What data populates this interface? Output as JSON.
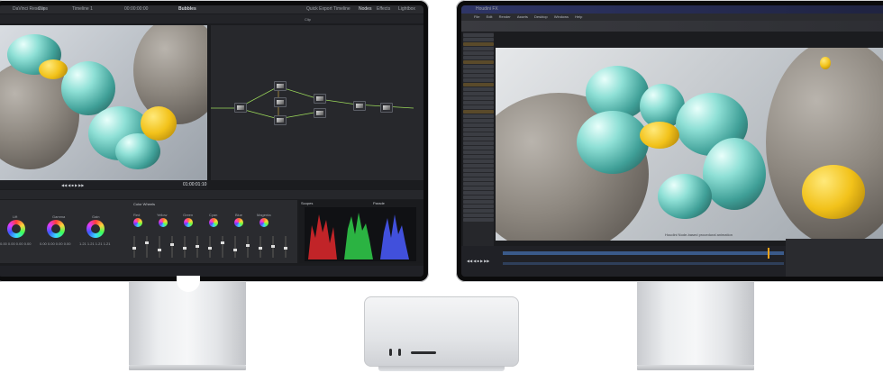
{
  "left_monitor": {
    "titlebar": {
      "app_label": "DaVinci Resolve",
      "tab1": "Clips",
      "timeline_label": "Timeline 1",
      "timecode": "00:00:00:00",
      "project_title": "Bubbles",
      "quick_export": "Quick Export",
      "timeline_btn": "Timeline",
      "nodes_btn": "Nodes",
      "effects_btn": "Effects",
      "lightbox_btn": "Lightbox",
      "clip_label": "Clip"
    },
    "viewer": {
      "timecode": "01:00:01:10"
    },
    "color_panel": {
      "section_title": "Color Wheels",
      "wheels": [
        {
          "label": "Lift",
          "values": "0.00 0.00 0.00 0.00"
        },
        {
          "label": "Gamma",
          "values": "0.00 0.00 0.00 0.00"
        },
        {
          "label": "Gain",
          "values": "1.21 1.21 1.21 1.21"
        },
        {
          "label": "Offset",
          "values": "25.00 25.00 25.00"
        }
      ],
      "hue_labels": [
        "Red",
        "Yellow",
        "Green",
        "Cyan",
        "Blue",
        "Magenta"
      ],
      "value_label": "0.00"
    },
    "scopes": {
      "title": "Scopes",
      "mode": "Parade"
    }
  },
  "right_monitor": {
    "titlebar": {
      "app_label": "Houdini FX"
    },
    "menu": [
      "File",
      "Edit",
      "Render",
      "Assets",
      "Desktop",
      "Windows",
      "Help"
    ],
    "caption": "Houdini Node-based procedural animation"
  },
  "colors": {
    "bezel": "#0b0b0c",
    "ui_dark": "#1b1c1f",
    "accent_teal": "#8fe0d6",
    "accent_gold": "#f2c21a",
    "stand_silver": "#e6e8ea"
  }
}
